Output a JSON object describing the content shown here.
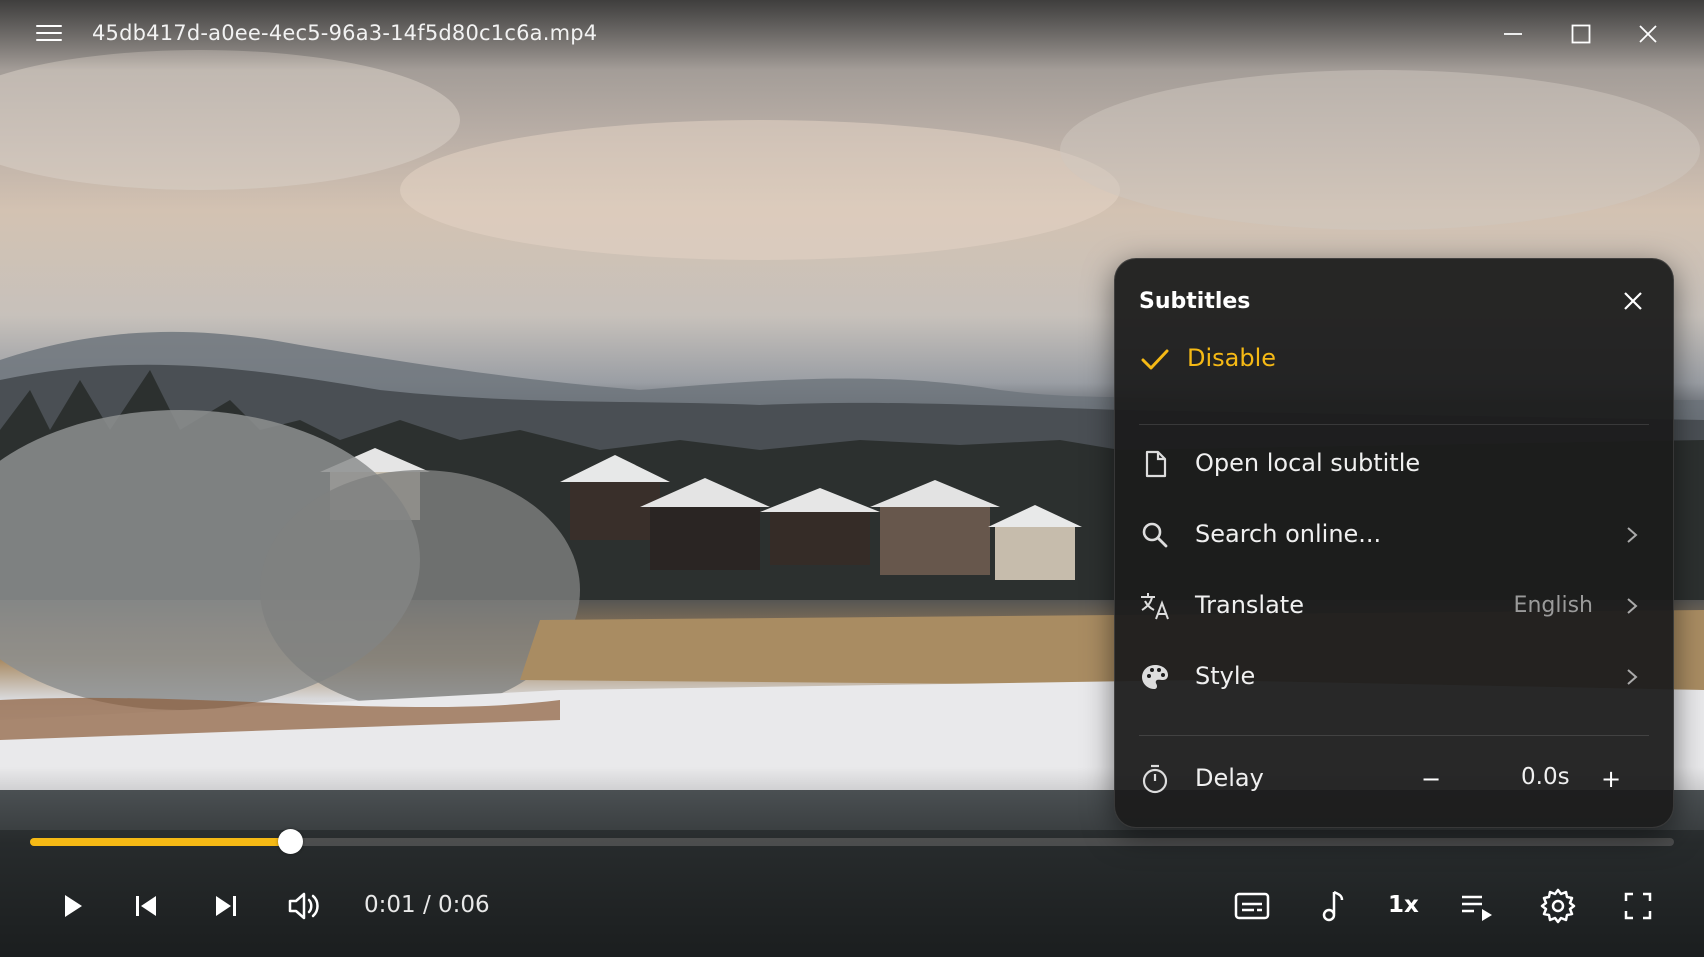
{
  "window": {
    "title": "45db417d-a0ee-4ec5-96a3-14f5d80c1c6a.mp4"
  },
  "player": {
    "progress_fraction": 0.158,
    "time": "0:01 / 0:06",
    "speed": "1x"
  },
  "subtitles_panel": {
    "title": "Subtitles",
    "disable_label": "Disable",
    "open_local_label": "Open local subtitle",
    "search_online_label": "Search online...",
    "translate_label": "Translate",
    "translate_value": "English",
    "style_label": "Style",
    "delay_label": "Delay",
    "delay_minus": "−",
    "delay_value": "0.0s",
    "delay_plus": "+"
  },
  "colors": {
    "accent": "#f5b915",
    "panel_bg": "#1c1c1c"
  },
  "icons": {
    "menu": "hamburger-icon",
    "minimize": "minimize-icon",
    "maximize": "maximize-icon",
    "close": "close-icon",
    "play": "play-icon",
    "previous": "skip-previous-icon",
    "next": "skip-next-icon",
    "volume": "volume-icon",
    "subtitles": "subtitles-icon",
    "audio": "music-note-icon",
    "playlist": "playlist-icon",
    "settings": "gear-icon",
    "fullscreen": "fullscreen-icon"
  }
}
